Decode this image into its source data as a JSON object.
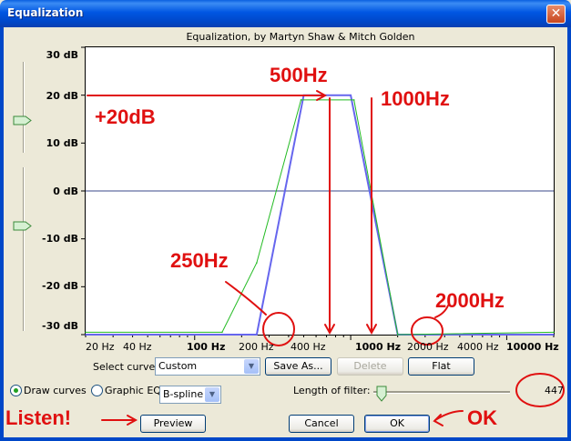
{
  "window": {
    "title": "Equalization",
    "close_glyph": "✕"
  },
  "plot": {
    "subtitle": "Equalization, by Martyn Shaw & Mitch Golden",
    "y_ticks": [
      "30 dB",
      "20 dB",
      "10 dB",
      "0 dB",
      "-10 dB",
      "-20 dB",
      "-30 dB"
    ],
    "x_ticks": [
      "20 Hz",
      "40 Hz",
      "100 Hz",
      "200 Hz",
      "400 Hz",
      "1000 Hz",
      "2000 Hz",
      "4000 Hz",
      "10000 Hz"
    ],
    "x_ticks_bold": [
      "100 Hz",
      "1000 Hz",
      "10000 Hz"
    ]
  },
  "chart_data": {
    "type": "line",
    "xscale": "log",
    "xlim": [
      20,
      20000
    ],
    "ylim": [
      -30,
      30
    ],
    "xlabel": "",
    "ylabel": "",
    "grid": false,
    "series": [
      {
        "color": "#6666EE",
        "x": [
          20,
          200,
          250,
          500,
          1000,
          2000,
          20000
        ],
        "y": [
          -30,
          -30,
          -30,
          20,
          20,
          -30,
          -30
        ]
      },
      {
        "color": "#22BB22",
        "x": [
          20,
          150,
          250,
          480,
          1050,
          2000,
          20000
        ],
        "y": [
          -29.5,
          -29.5,
          -15,
          19,
          19,
          -30,
          -29.5
        ]
      }
    ]
  },
  "annotations": {
    "hz500": "500Hz",
    "hz1000": "1000Hz",
    "plus20": "+20dB",
    "hz250": "250Hz",
    "hz2000": "2000Hz",
    "listen": "Listen!",
    "ok": "OK",
    "color": "#E01010"
  },
  "controls": {
    "select_curve_label": "Select curve:",
    "select_curve_value": "Custom",
    "save_as": "Save As...",
    "delete": "Delete",
    "flat": "Flat",
    "draw_curves": "Draw curves",
    "graphic_eq": "Graphic EQ",
    "interp_value": "B-spline",
    "length_label": "Length of filter:",
    "length_value": "447",
    "length_slider_fraction": 0.02,
    "preview": "Preview",
    "cancel": "Cancel",
    "ok": "OK",
    "dropdown_glyph": "▼"
  }
}
